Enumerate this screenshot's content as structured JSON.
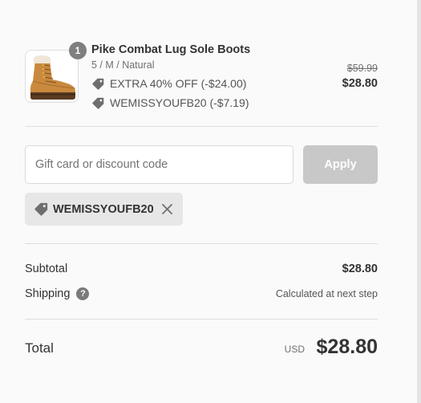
{
  "product": {
    "quantity": "1",
    "name": "Pike Combat Lug Sole Boots",
    "variant": "5 / M / Natural",
    "discounts": [
      {
        "icon": "tag-icon",
        "label": "EXTRA 40% OFF (-$24.00)"
      },
      {
        "icon": "tag-icon",
        "label": "WEMISSYOUFB20 (-$7.19)"
      }
    ],
    "original_price": "$59.99",
    "final_price": "$28.80",
    "image_icon": "boot-image"
  },
  "discount_form": {
    "placeholder": "Gift card or discount code",
    "value": "",
    "apply_label": "Apply",
    "applied_code": "WEMISSYOUFB20",
    "remove_icon": "close-icon"
  },
  "summary": {
    "subtotal_label": "Subtotal",
    "subtotal_value": "$28.80",
    "shipping_label": "Shipping",
    "shipping_help": "?",
    "shipping_value": "Calculated at next step",
    "total_label": "Total",
    "currency": "USD",
    "total_value": "$28.80"
  },
  "colors": {
    "background": "#fafafa",
    "text": "#333333",
    "apply_disabled": "#c8c8c8",
    "chip_bg": "#e7e7e7",
    "badge": "#7f7f7f"
  }
}
